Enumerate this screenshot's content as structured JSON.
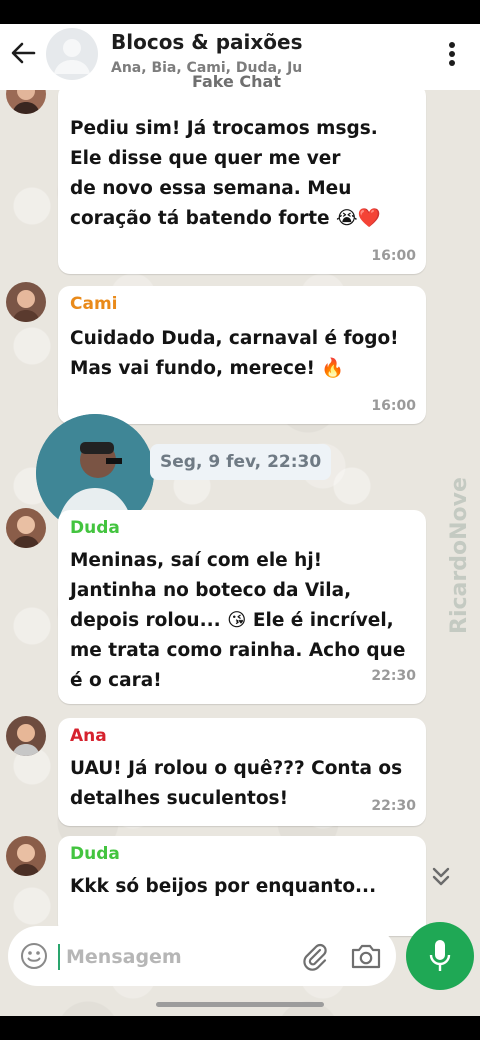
{
  "header": {
    "title": "Blocos & paixões",
    "members": "Ana, Bia, Cami, Duda, Ju",
    "watermark": "Fake Chat"
  },
  "messages": [
    {
      "sender": "",
      "text": "Pediu sim! Já trocamos msgs.\nEle disse que quer me ver\nde novo essa semana. Meu\ncoração tá batendo forte 😭❤️",
      "time": "16:00"
    },
    {
      "sender": "Cami",
      "sender_color": "#e98a1a",
      "text": "Cuidado Duda, carnaval é fogo!\nMas vai fundo, merece! 🔥",
      "time": "16:00"
    },
    {
      "sender": "Duda",
      "sender_color": "#43c43f",
      "text": "Meninas, saí com ele hj!\nJantinha no boteco da Vila,\ndepois rolou... 😘 Ele é incrível,\nme trata como rainha. Acho que\né o cara!",
      "time": "22:30"
    },
    {
      "sender": "Ana",
      "sender_color": "#d6222e",
      "text": "UAU! Já rolou o quê??? Conta os\ndetalhes suculentos!",
      "time": "22:30"
    },
    {
      "sender": "Duda",
      "sender_color": "#43c43f",
      "text": "Kkk só beijos por enquanto...",
      "time": ""
    }
  ],
  "date_divider": "Seg, 9 fev, 22:30",
  "input": {
    "placeholder": "Mensagem",
    "value": ""
  },
  "colors": {
    "accent": "#1fa855",
    "header_bg": "#ffffff",
    "chat_bg": "#e9e6df"
  },
  "icons": {
    "back": "arrow-left-icon",
    "menu": "more-vert-icon",
    "emoji": "smiley-icon",
    "attach": "paperclip-icon",
    "camera": "camera-icon",
    "mic": "microphone-icon",
    "scroll": "double-chevron-down-icon"
  }
}
